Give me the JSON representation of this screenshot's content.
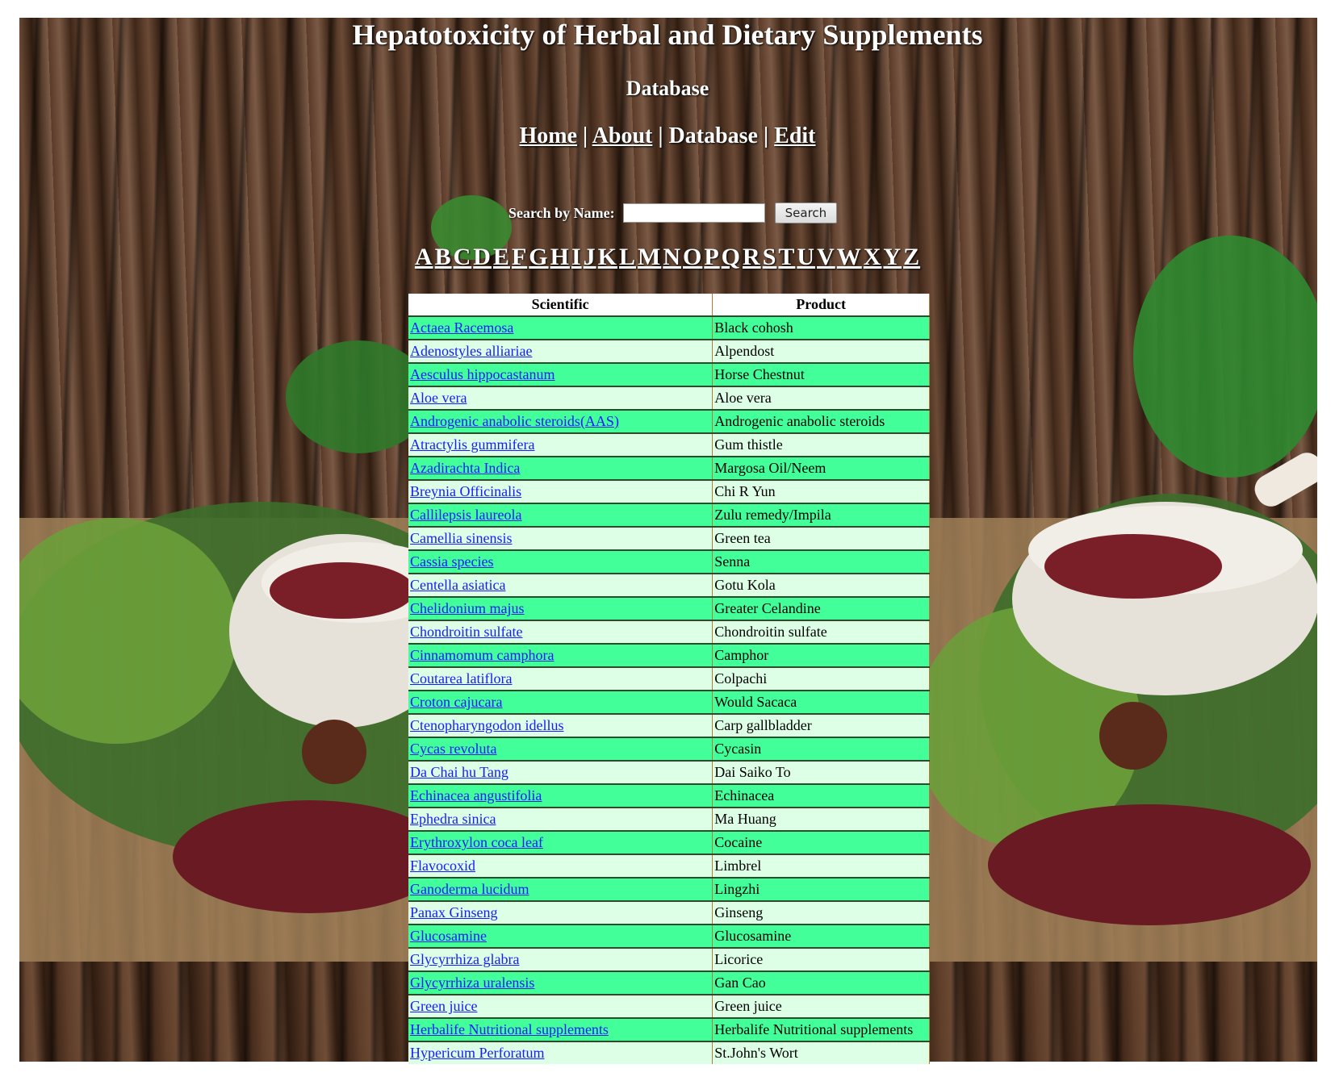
{
  "header": {
    "title": "Hepatotoxicity of Herbal and Dietary Supplements",
    "subtitle": "Database"
  },
  "nav": {
    "items": [
      {
        "label": "Home",
        "link": true
      },
      {
        "label": "About",
        "link": true
      },
      {
        "label": "Database",
        "link": false
      },
      {
        "label": "Edit",
        "link": true
      }
    ],
    "separator": "|"
  },
  "search": {
    "label": "Search by Name:",
    "value": "",
    "button": "Search"
  },
  "alphabet": [
    "A",
    "B",
    "C",
    "D",
    "E",
    "F",
    "G",
    "H",
    "I",
    "J",
    "K",
    "L",
    "M",
    "N",
    "O",
    "P",
    "Q",
    "R",
    "S",
    "T",
    "U",
    "V",
    "W",
    "X",
    "Y",
    "Z"
  ],
  "table": {
    "headers": [
      "Scientific",
      "Product"
    ],
    "rows": [
      [
        "Actaea Racemosa",
        "Black cohosh"
      ],
      [
        "Adenostyles alliariae",
        "Alpendost"
      ],
      [
        "Aesculus hippocastanum",
        "Horse Chestnut"
      ],
      [
        "Aloe vera",
        "Aloe vera"
      ],
      [
        "Androgenic anabolic steroids(AAS)",
        "Androgenic anabolic steroids"
      ],
      [
        "Atractylis gummifera",
        "Gum thistle"
      ],
      [
        "Azadirachta Indica",
        "Margosa Oil/Neem"
      ],
      [
        "Breynia Officinalis",
        "Chi R Yun"
      ],
      [
        "Callilepsis laureola",
        "Zulu remedy/Impila"
      ],
      [
        "Camellia sinensis",
        "Green tea"
      ],
      [
        "Cassia species",
        "Senna"
      ],
      [
        "Centella asiatica",
        "Gotu Kola"
      ],
      [
        "Chelidonium majus",
        "Greater Celandine"
      ],
      [
        "Chondroitin sulfate",
        "Chondroitin sulfate"
      ],
      [
        "Cinnamomum camphora",
        "Camphor"
      ],
      [
        "Coutarea latiflora",
        "Colpachi"
      ],
      [
        "Croton cajucara",
        "Would Sacaca"
      ],
      [
        "Ctenopharyngodon idellus",
        "Carp gallbladder"
      ],
      [
        "Cycas revoluta",
        "Cycasin"
      ],
      [
        "Da Chai hu Tang",
        "Dai Saiko To"
      ],
      [
        "Echinacea angustifolia",
        "Echinacea"
      ],
      [
        "Ephedra sinica",
        "Ma Huang"
      ],
      [
        "Erythroxylon coca leaf",
        "Cocaine"
      ],
      [
        "Flavocoxid",
        "Limbrel"
      ],
      [
        "Ganoderma lucidum",
        "Lingzhi"
      ],
      [
        "Panax Ginseng",
        "Ginseng"
      ],
      [
        "Glucosamine",
        "Glucosamine"
      ],
      [
        "Glycyrrhiza glabra",
        "Licorice"
      ],
      [
        "Glycyrrhiza uralensis",
        "Gan Cao"
      ],
      [
        "Green juice",
        "Green juice"
      ],
      [
        "Herbalife Nutritional supplements",
        "Herbalife Nutritional supplements"
      ],
      [
        "Hypericum Perforatum",
        "St.John's Wort"
      ]
    ]
  },
  "colors": {
    "row_odd": "#42ff9a",
    "row_even": "#dcffe6",
    "link": "#1a1aff"
  }
}
